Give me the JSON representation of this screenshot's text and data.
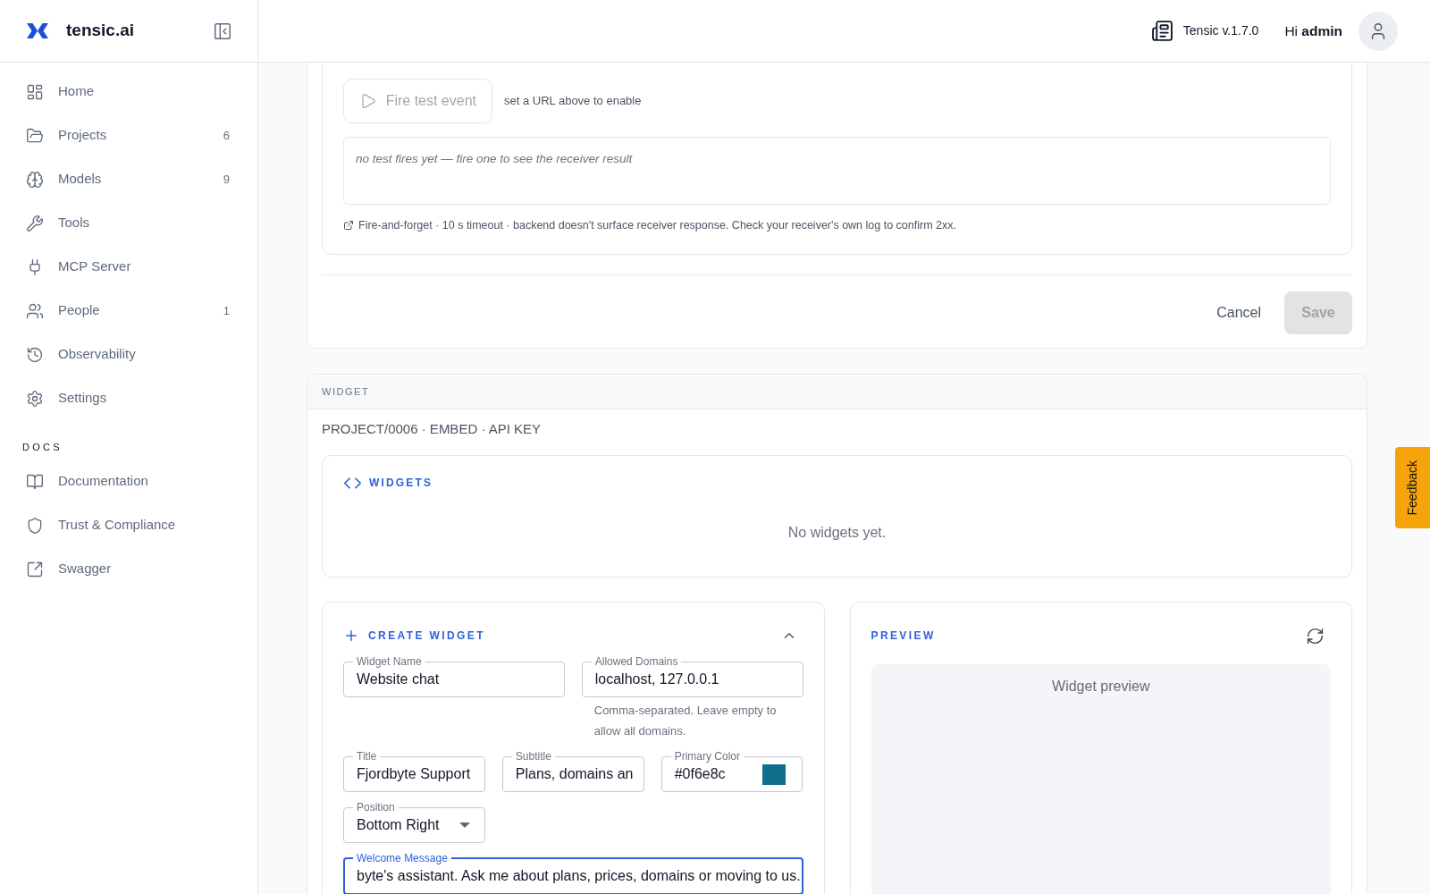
{
  "sidebar": {
    "brand": "tensic.ai",
    "nav": [
      {
        "label": "Home",
        "selected": false
      },
      {
        "label": "Projects",
        "count": "6",
        "selected": false
      },
      {
        "label": "Models",
        "count": "9",
        "selected": false
      },
      {
        "label": "Tools",
        "selected": false
      },
      {
        "label": "MCP Server",
        "selected": false
      },
      {
        "label": "People",
        "count": "1",
        "selected": false
      },
      {
        "label": "Observability",
        "selected": false
      },
      {
        "label": "Settings",
        "selected": false
      }
    ],
    "docs_heading": "DOCS",
    "docs": [
      {
        "label": "Documentation",
        "selected": false
      },
      {
        "label": "Trust & Compliance",
        "selected": false
      },
      {
        "label": "Swagger",
        "selected": false
      }
    ]
  },
  "header": {
    "version": "Tensic v.1.7.0",
    "greeting": "Hi **admin**"
  },
  "webhook_test": {
    "fire_button": {
      "label": "Fire test event",
      "disabled": true
    },
    "hint": "set a URL above to enable",
    "result_message": "no test fires yet — fire one to see the receiver result",
    "note": "Fire-and-forget · 10 s timeout · backend doesn't surface receiver response. Check your receiver's own log to confirm 2xx."
  },
  "form_actions": {
    "cancel": "Cancel",
    "save": {
      "label": "Save",
      "disabled": true
    }
  },
  "widget_section": {
    "heading": "WIDGET",
    "breadcrumb": "PROJECT/0006 · EMBED · API KEY",
    "widgets_panel": {
      "title": "WIDGETS",
      "empty_text": "No widgets yet."
    },
    "create_widget": {
      "title": "CREATE WIDGET",
      "expanded": true,
      "rows": [
        {
          "fields": [
            {
              "kind": "text",
              "label": "Widget Name",
              "value": "Website chat",
              "focused": false
            },
            {
              "kind": "text",
              "label": "Allowed Domains",
              "value": "localhost, 127.0.0.1",
              "helper": "Comma-separated. Leave empty to allow all domains.",
              "focused": false
            }
          ]
        },
        {
          "fields": [
            {
              "kind": "text",
              "label": "Title",
              "value": "Fjordbyte Support",
              "focused": false
            },
            {
              "kind": "text",
              "label": "Subtitle",
              "value": "Plans, domains an",
              "focused": false
            },
            {
              "kind": "color",
              "label": "Primary Color",
              "value": "#0f6e8c",
              "color": "#0f6e8c",
              "focused": false
            }
          ]
        },
        {
          "fields": [
            {
              "kind": "select",
              "label": "Position",
              "value": "Bottom Right",
              "focused": false
            }
          ]
        },
        {
          "fields": [
            {
              "kind": "text",
              "label": "Welcome Message",
              "value": "byte's assistant. Ask me about plans, prices, domains or moving to us.",
              "focused": true
            }
          ]
        }
      ]
    },
    "preview": {
      "title": "PREVIEW",
      "empty_text": "Widget preview"
    }
  },
  "feedback_tab": "Feedback"
}
